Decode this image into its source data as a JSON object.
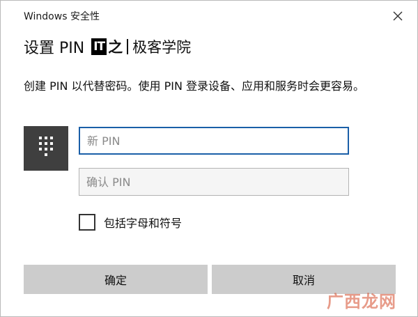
{
  "window": {
    "title": "Windows 安全性"
  },
  "header": {
    "title": "设置 PIN",
    "logo_it": "IT",
    "logo_zhi": "之",
    "logo_brand": "极客学院"
  },
  "description": "创建 PIN 以代替密码。使用 PIN 登录设备、应用和服务时会更容易。",
  "inputs": {
    "new_pin": {
      "placeholder": "新 PIN",
      "value": ""
    },
    "confirm_pin": {
      "placeholder": "确认 PIN",
      "value": ""
    }
  },
  "checkbox": {
    "label": "包括字母和符号",
    "checked": false
  },
  "buttons": {
    "ok": "确定",
    "cancel": "取消"
  },
  "watermark": "广西龙网",
  "icons": {
    "close": "close-icon",
    "keypad": "keypad-icon"
  },
  "colors": {
    "button_bg": "#cccccc",
    "keypad_tile": "#3f3f3f",
    "focus_border": "#1a5fa8"
  }
}
